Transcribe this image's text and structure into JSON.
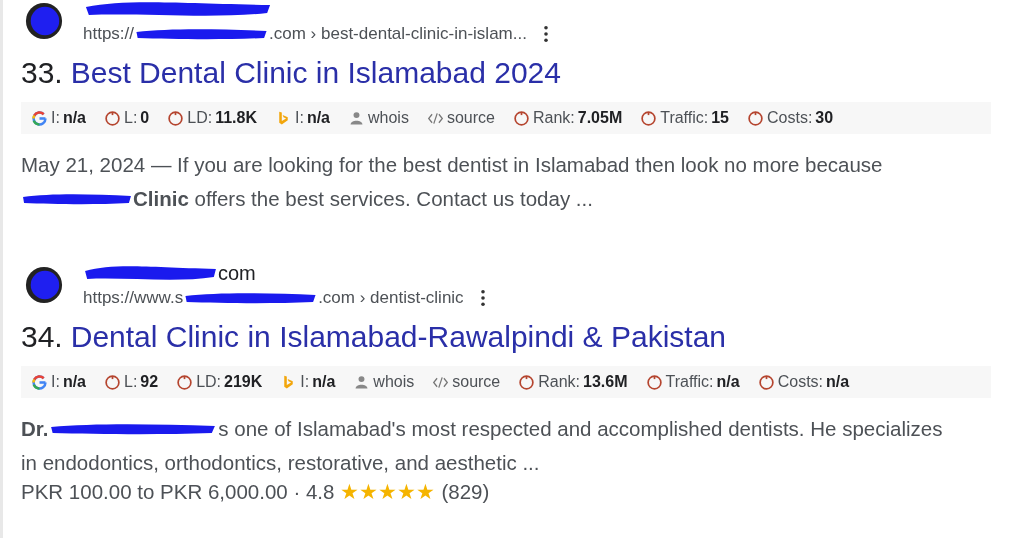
{
  "results": [
    {
      "number": "33.",
      "url_prefix": "https://",
      "url_suffix": ".com › best-dental-clinic-in-islam...",
      "title": "Best Dental Clinic in Islamabad 2024",
      "metrics": [
        {
          "kind": "google",
          "label": "I:",
          "value": "n/a"
        },
        {
          "kind": "circle",
          "label": "L:",
          "value": "0"
        },
        {
          "kind": "circle",
          "label": "LD:",
          "value": "11.8K"
        },
        {
          "kind": "bing",
          "label": "I:",
          "value": "n/a"
        },
        {
          "kind": "whois",
          "label": "whois"
        },
        {
          "kind": "source",
          "label": "source"
        },
        {
          "kind": "circle",
          "label": "Rank:",
          "value": "7.05M"
        },
        {
          "kind": "circle",
          "label": "Traffic:",
          "value": "15"
        },
        {
          "kind": "circle",
          "label": "Costs:",
          "value": "30"
        }
      ],
      "snippet_lines": [
        [
          {
            "kind": "text",
            "text": "May 21, 2024 — If you are looking for the best dentist in Islamabad then look no more because"
          }
        ],
        [
          {
            "kind": "redaction"
          },
          {
            "kind": "text",
            "text": "**Clinic** offers the best services. Contact us today ..."
          }
        ]
      ]
    },
    {
      "number": "34.",
      "site_name_suffix": "com",
      "url_prefix": "https://www.s",
      "url_suffix": ".com › dentist-clinic",
      "title": "Dental Clinic in Islamabad-Rawalpindi & Pakistan",
      "metrics": [
        {
          "kind": "google",
          "label": "I:",
          "value": "n/a"
        },
        {
          "kind": "circle",
          "label": "L:",
          "value": "92"
        },
        {
          "kind": "circle",
          "label": "LD:",
          "value": "219K"
        },
        {
          "kind": "bing",
          "label": "I:",
          "value": "n/a"
        },
        {
          "kind": "whois",
          "label": "whois"
        },
        {
          "kind": "source",
          "label": "source"
        },
        {
          "kind": "circle",
          "label": "Rank:",
          "value": "13.6M"
        },
        {
          "kind": "circle",
          "label": "Traffic:",
          "value": "n/a"
        },
        {
          "kind": "circle",
          "label": "Costs:",
          "value": "n/a"
        }
      ],
      "snippet_lines": [
        [
          {
            "kind": "text",
            "text": "**Dr.**"
          },
          {
            "kind": "redaction"
          },
          {
            "kind": "text",
            "text": "s one of Islamabad's most respected and accomplished dentists. He specializes"
          }
        ],
        [
          {
            "kind": "text",
            "text": "in endodontics, orthodontics, restorative, and aesthetic ..."
          }
        ]
      ],
      "price": "PKR 100.00 to PKR 6,000.00 · 4.8",
      "stars": 5,
      "review_count": "(829)"
    }
  ]
}
